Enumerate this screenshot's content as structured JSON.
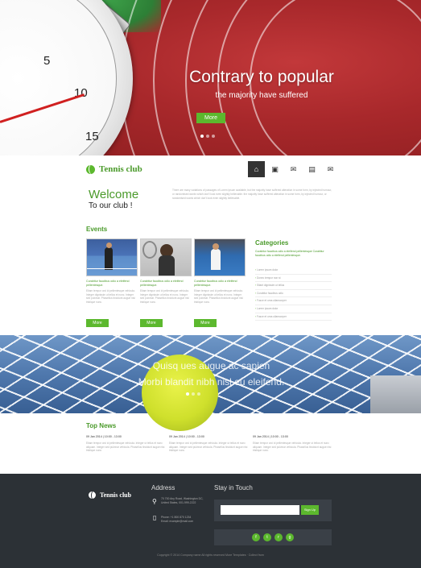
{
  "hero": {
    "title": "Contrary to popular",
    "subtitle": "the majority have suffered",
    "button": "More",
    "watch_numbers": [
      "5",
      "10",
      "15"
    ]
  },
  "header": {
    "logo": "Tennis club",
    "nav": [
      {
        "icon": "home-icon",
        "glyph": "⌂",
        "active": true
      },
      {
        "icon": "briefcase-icon",
        "glyph": "▣",
        "active": false
      },
      {
        "icon": "chat-icon",
        "glyph": "✉",
        "active": false
      },
      {
        "icon": "gallery-icon",
        "glyph": "▤",
        "active": false
      },
      {
        "icon": "mail-icon",
        "glyph": "✉",
        "active": false
      }
    ]
  },
  "welcome": {
    "title": "Welcome",
    "subtitle": "To our club !",
    "text": "There are many variations of passages of Lorem Ipsum available, but the majority have suffered alteration in some form, by injected humour, or randomised words which don't look even slightly believable. the majority have suffered alteration in some form, by injected humour, or randomised words which don't look even slightly believable."
  },
  "events": {
    "heading": "Events",
    "items": [
      {
        "title": "Curabitur faucibus odio a eleifend pellentesque.",
        "text": "Etiam tempor orci id pellentesque vehicula. Integer dignissim ut tellus et nunc. Integer sed pulvinar. Phasellus tincidunt augue nisi tristique nunc.",
        "button": "More"
      },
      {
        "title": "Curabitur faucibus odio a eleifend pellentesque.",
        "text": "Etiam tempor orci id pellentesque vehicula. Integer dignissim ut tellus et nunc. Integer sed pulvinar. Phasellus tincidunt augue nisi tristique nunc.",
        "button": "More"
      },
      {
        "title": "Curabitur faucibus odio a eleifend pellentesque.",
        "text": "Etiam tempor orci id pellentesque vehicula. Integer dignissim ut tellus et nunc. Integer sed pulvinar. Phasellus tincidunt augue nisi tristique nunc.",
        "button": "More"
      }
    ]
  },
  "categories": {
    "heading": "Categories",
    "intro": "Curabitur faucibus odio a eleifend pellentesque Curabitur faucibus odio a eleifend pellentesque.",
    "items": [
      "Lorem ipsum dolor",
      "Donec tempor non st",
      "Sitant dignissim ut tellus",
      "Curabitur faucibus odio",
      "Fusce et urna ullamcorper",
      "Lorem ipsum dolor",
      "Fusce et urna ullamcorper"
    ]
  },
  "banner": {
    "line1": "Quisq ues augue ac sapien",
    "line2": "Morbi blandit nibh nisl eu eleifend."
  },
  "news": {
    "heading": "Top News",
    "items": [
      {
        "date": "09 Jan 2014  |  10:00 - 13:00",
        "text": "Etiam tempor orci id pellentesque vehicula. Integer ut tellus et nunc aliquam. Integer sed pulvinar vehicula. Phasellus tincidunt augue nisi tristique nunc."
      },
      {
        "date": "09 Jan 2014  |  10:00 - 13:00",
        "text": "Etiam tempor orci id pellentesque vehicula. Integer ut tellus et nunc aliquam. Integer sed pulvinar vehicula. Phasellus tincidunt augue nisi tristique nunc."
      },
      {
        "date": "09 Jan 2014  |  10:00 - 13:00",
        "text": "Etiam tempor orci id pellentesque vehicula. Integer ut tellus et nunc aliquam. Integer sed pulvinar vehicula. Phasellus tincidunt augue nisi tristique nunc."
      }
    ]
  },
  "footer": {
    "logo": "Tennis club",
    "address_heading": "Address",
    "address": "70 700 Any Road, Washington DC, United States, 001-999-2222",
    "phone": "Phone: +1 800 870 1234",
    "email": "Email: example@mail.com",
    "touch_heading": "Stay in Touch",
    "signup": "Sign Up",
    "social": [
      {
        "icon": "facebook-icon",
        "glyph": "f"
      },
      {
        "icon": "twitter-icon",
        "glyph": "t"
      },
      {
        "icon": "rss-icon",
        "glyph": "r"
      },
      {
        "icon": "google-plus-icon",
        "glyph": "g"
      }
    ],
    "copyright": "Copyright © 2014 Company name All rights reserved More Templates · Collect from"
  },
  "colors": {
    "accent": "#5cb82e",
    "track": "#a8282b",
    "footer": "#2c3136"
  }
}
